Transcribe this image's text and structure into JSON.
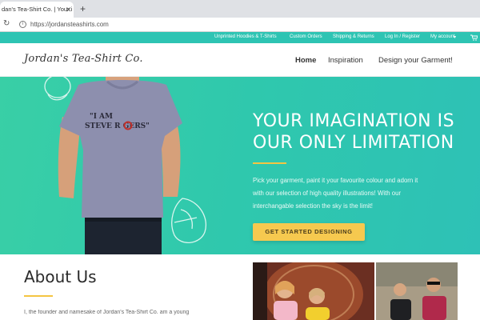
{
  "browser": {
    "tab_title": "dan's Tea-Shirt Co. | Your i",
    "tab_close": "✕",
    "new_tab": "+",
    "url": "https://jordansteashirts.com"
  },
  "topnav": {
    "items": [
      "Unprinted Hoodies & T-Shirts",
      "Custom Orders",
      "Shipping & Returns",
      "Log In / Register",
      "My account"
    ]
  },
  "header": {
    "logo": "Jordan's Tea-Shirt Co.",
    "nav": [
      "Home",
      "Inspiration",
      "Design your Garment!"
    ]
  },
  "hero": {
    "title_line1": "YOUR IMAGINATION IS",
    "title_line2": "OUR ONLY LIMITATION",
    "text_line1": "Pick your garment, paint it your favourite colour and adorn it",
    "text_line2": "with our selection of high quality illustrations! With our",
    "text_line3": "interchangable selection the sky is the limit!",
    "cta": "GET STARTED DESIGNING",
    "shirt_text_line1": "\"I AM",
    "shirt_text_line2": "STEVE R   GERS\""
  },
  "about": {
    "title": "About Us",
    "text": "I, the founder and namesake of Jordan's Tea-Shirt Co. am a young"
  },
  "colors": {
    "brand_teal": "#2ec4b3",
    "accent_yellow": "#f6c94f"
  }
}
